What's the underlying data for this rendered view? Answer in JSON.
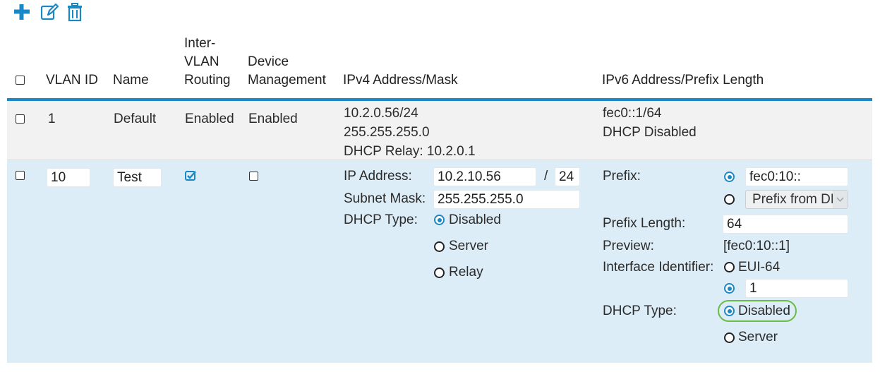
{
  "toolbar": {
    "add_icon": "plus-icon",
    "edit_icon": "edit-icon",
    "delete_icon": "trash-icon",
    "accent_color": "#1a88c4"
  },
  "table": {
    "headers": {
      "vlan_id": "VLAN ID",
      "name": "Name",
      "inter_vlan_routing": [
        "Inter-",
        "VLAN",
        "Routing"
      ],
      "device_management": [
        "Device",
        "Management"
      ],
      "ipv4": "IPv4 Address/Mask",
      "ipv6": "IPv6 Address/Prefix Length"
    },
    "row1": {
      "vlan_id": "1",
      "name": "Default",
      "inter_vlan_routing": "Enabled",
      "device_management": "Enabled",
      "ipv4": [
        "10.2.0.56/24",
        "255.255.255.0",
        "DHCP Relay: 10.2.0.1"
      ],
      "ipv6": [
        "fec0::1/64",
        "DHCP Disabled"
      ]
    },
    "row2": {
      "vlan_id": "10",
      "name": "Test",
      "inter_vlan_routing_checked": true,
      "device_management_checked": false,
      "ipv4": {
        "ip_label": "IP Address:",
        "ip_value": "10.2.10.56",
        "slash": "/",
        "prefix_value": "24",
        "mask_label": "Subnet Mask:",
        "mask_value": "255.255.255.0",
        "dhcp_label": "DHCP Type:",
        "dhcp_options": [
          "Disabled",
          "Server",
          "Relay"
        ],
        "dhcp_selected": "Disabled"
      },
      "ipv6": {
        "prefix_label": "Prefix:",
        "prefix_value": "fec0:10::",
        "prefix_dhcp_option": "Prefix from DHCP",
        "prefix_length_label": "Prefix Length:",
        "prefix_length_value": "64",
        "preview_label": "Preview:",
        "preview_value": "[fec0:10::1]",
        "iface_label": "Interface Identifier:",
        "iface_eui": "EUI-64",
        "iface_value": "1",
        "dhcp_label": "DHCP Type:",
        "dhcp_options": [
          "Disabled",
          "Server"
        ],
        "dhcp_selected": "Disabled",
        "highlight_color": "#6cbb46"
      }
    },
    "colors": {
      "header_rule": "#1a88c4",
      "row1_bg": "#f2f2f2",
      "row2_bg": "#dcedf7"
    }
  }
}
